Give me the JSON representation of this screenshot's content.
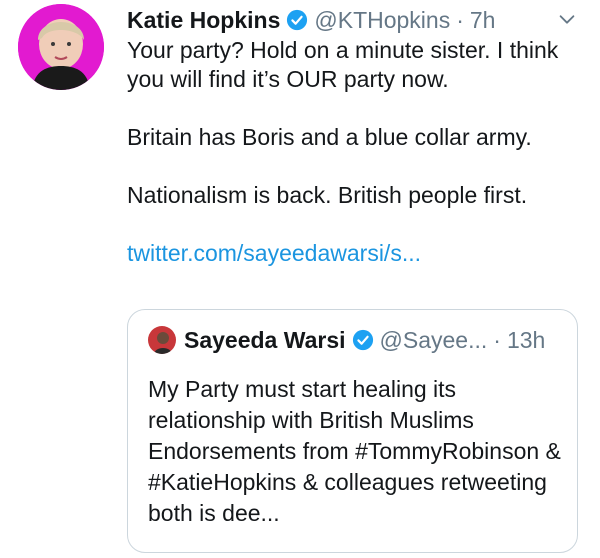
{
  "tweet": {
    "author_name": "Katie Hopkins",
    "handle": "@KTHopkins",
    "separator": "·",
    "time": "7h",
    "lines": [
      "Your party? Hold on a minute sister. I think you will find it’s OUR party now.",
      "Britain has Boris and a blue collar army.",
      "Nationalism is back. British people first."
    ],
    "link_text": "twitter.com/sayeedawarsi/s..."
  },
  "quoted": {
    "author_name": "Sayeeda Warsi",
    "handle": "@Sayee...",
    "separator": "·",
    "time": "13h",
    "text": "My Party must start healing its relationship with British Muslims Endorsements from #TommyRobinson & #KatieHopkins & colleagues retweeting both is dee..."
  },
  "colors": {
    "verified": "#1da1f2",
    "link": "#1b95e0",
    "avatar_background": "#e21ad0"
  },
  "icons": [
    "verified-badge-icon",
    "chevron-down-icon"
  ]
}
